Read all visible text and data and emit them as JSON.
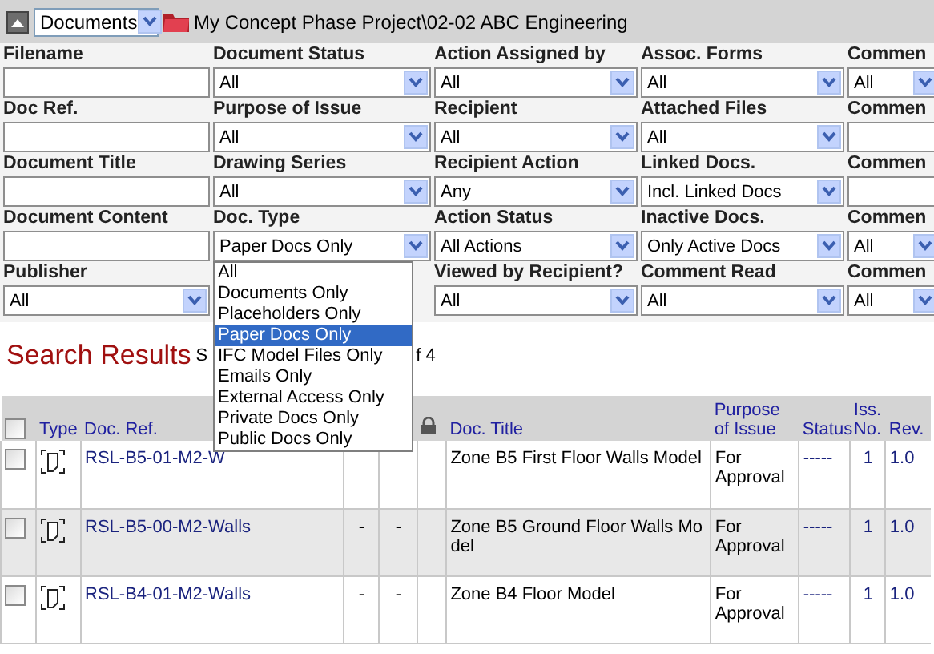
{
  "toolbar": {
    "view_select": "Documents",
    "path": "My Concept Phase Project\\02-02 ABC Engineering"
  },
  "filter_columns": [
    [
      {
        "label": "Filename",
        "kind": "text"
      },
      {
        "label": "Doc Ref.",
        "kind": "text"
      },
      {
        "label": "Document Title",
        "kind": "text"
      },
      {
        "label": "Document Content",
        "kind": "text"
      },
      {
        "label": "Publisher",
        "kind": "select",
        "value": "All"
      }
    ],
    [
      {
        "label": "Document Status",
        "kind": "select",
        "value": "All"
      },
      {
        "label": "Purpose of Issue",
        "kind": "select",
        "value": "All"
      },
      {
        "label": "Drawing Series",
        "kind": "select",
        "value": "All"
      },
      {
        "label": "Doc. Type",
        "kind": "select",
        "value": "Paper Docs Only",
        "expanded": true,
        "options": [
          {
            "label": "All",
            "selected": false
          },
          {
            "label": "Documents Only",
            "selected": false
          },
          {
            "label": "Placeholders Only",
            "selected": false
          },
          {
            "label": "Paper Docs Only",
            "selected": true
          },
          {
            "label": "IFC Model Files Only",
            "selected": false
          },
          {
            "label": "Emails Only",
            "selected": false
          },
          {
            "label": "External Access Only",
            "selected": false
          },
          {
            "label": "Private Docs Only",
            "selected": false
          },
          {
            "label": "Public Docs Only",
            "selected": false
          }
        ]
      }
    ],
    [
      {
        "label": "Action Assigned by",
        "kind": "select",
        "value": "All"
      },
      {
        "label": "Recipient",
        "kind": "select",
        "value": "All"
      },
      {
        "label": "Recipient Action",
        "kind": "select",
        "value": "Any"
      },
      {
        "label": "Action Status",
        "kind": "select",
        "value": "All Actions"
      },
      {
        "label": "Viewed by Recipient?",
        "kind": "select",
        "value": "All"
      }
    ],
    [
      {
        "label": "Assoc. Forms",
        "kind": "select",
        "value": "All"
      },
      {
        "label": "Attached Files",
        "kind": "select",
        "value": "All"
      },
      {
        "label": "Linked Docs.",
        "kind": "select",
        "value": "Incl. Linked Docs"
      },
      {
        "label": "Inactive Docs.",
        "kind": "select",
        "value": "Only Active Docs"
      },
      {
        "label": "Comment Read",
        "kind": "select",
        "value": "All"
      }
    ],
    [
      {
        "label": "Commen",
        "kind": "select",
        "value": "All"
      },
      {
        "label": "Commen",
        "kind": "text"
      },
      {
        "label": "Commen",
        "kind": "text"
      },
      {
        "label": "Commen",
        "kind": "select",
        "value": "All"
      },
      {
        "label": "Commen",
        "kind": "select",
        "value": "All"
      }
    ]
  ],
  "results": {
    "title": "Search Results",
    "summary_left": "S",
    "summary_right": "f 4"
  },
  "table": {
    "select_all_checked": false,
    "columns": [
      "Type",
      "Doc. Ref.",
      "",
      "",
      "",
      "Doc. Title",
      "Purpose of Issue",
      "Status",
      "Iss. No.",
      "Rev."
    ],
    "rows": [
      {
        "checked": false,
        "highlighted": false,
        "doc_ref": "RSL-B5-01-M2-W",
        "column_3": "",
        "column_4": "",
        "title": "Zone B5 First Floor Walls Model",
        "purpose": "For Approval",
        "status": "-----",
        "iss_no": "1",
        "rev": "1.0"
      },
      {
        "checked": false,
        "highlighted": true,
        "doc_ref": "RSL-B5-00-M2-Walls",
        "column_3": "-",
        "column_4": "-",
        "title": "Zone B5 Ground Floor Walls Model",
        "purpose": "For Approval",
        "status": "-----",
        "iss_no": "1",
        "rev": "1.0"
      },
      {
        "checked": false,
        "highlighted": false,
        "doc_ref": "RSL-B4-01-M2-Walls",
        "column_3": "-",
        "column_4": "-",
        "title": "Zone B4 Floor Model",
        "purpose": "For Approval",
        "status": "-----",
        "iss_no": "1",
        "rev": "1.0"
      }
    ]
  }
}
